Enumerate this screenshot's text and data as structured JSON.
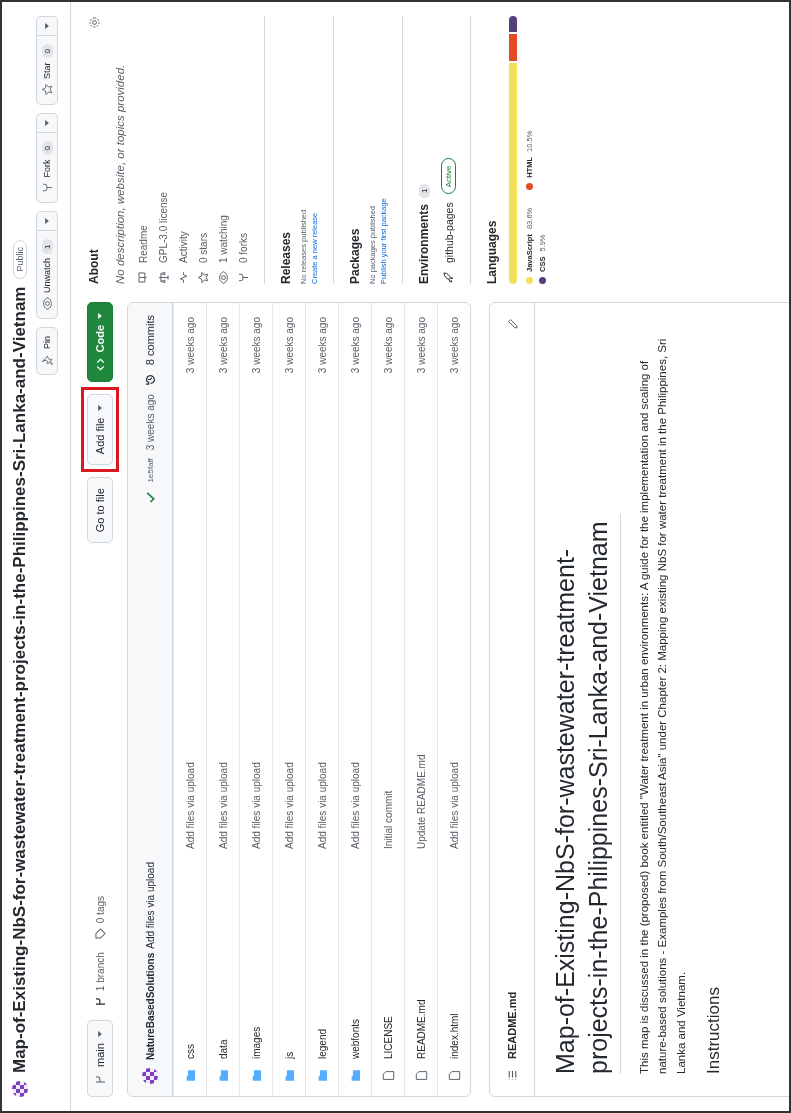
{
  "repo": {
    "title": "Map-of-Existing-NbS-for-wastewater-treatment-projects-in-the-Philippines-Sri-Lanka-and-Vietnam",
    "visibility": "Public"
  },
  "actions": [
    {
      "kind": "pin",
      "label": "Pin"
    },
    {
      "kind": "watch",
      "label": "Unwatch",
      "count": "1"
    },
    {
      "kind": "fork",
      "label": "Fork",
      "count": "0"
    },
    {
      "kind": "star",
      "label": "Star",
      "count": "0"
    }
  ],
  "branch_bar": {
    "branch": "main",
    "branches": "1 branch",
    "tags": "0 tags",
    "go_to_file": "Go to file",
    "add_file": {
      "label": "Add file",
      "highlighted": true
    },
    "code": "Code"
  },
  "latest_commit": {
    "author": "NatureBasedSolutions",
    "message": "Add files via upload",
    "hash": "1e5faff",
    "time": "3 weeks ago",
    "commits": "8 commits"
  },
  "files": [
    {
      "kind": "dir",
      "name": "css",
      "message": "Add files via upload",
      "time": "3 weeks ago"
    },
    {
      "kind": "dir",
      "name": "data",
      "message": "Add files via upload",
      "time": "3 weeks ago"
    },
    {
      "kind": "dir",
      "name": "images",
      "message": "Add files via upload",
      "time": "3 weeks ago"
    },
    {
      "kind": "dir",
      "name": "js",
      "message": "Add files via upload",
      "time": "3 weeks ago"
    },
    {
      "kind": "dir",
      "name": "legend",
      "message": "Add files via upload",
      "time": "3 weeks ago"
    },
    {
      "kind": "dir",
      "name": "webfonts",
      "message": "Add files via upload",
      "time": "3 weeks ago"
    },
    {
      "kind": "file",
      "name": "LICENSE",
      "message": "Initial commit",
      "time": "3 weeks ago"
    },
    {
      "kind": "file",
      "name": "README.md",
      "message": "Update README.md",
      "time": "3 weeks ago"
    },
    {
      "kind": "file",
      "name": "index.html",
      "message": "Add files via upload",
      "time": "3 weeks ago"
    }
  ],
  "readme": {
    "filename": "README.md",
    "heading": "Map-of-Existing-NbS-for-wastewater-treatment-projects-in-the-Philippines-Sri-Lanka-and-Vietnam",
    "paragraph": "This map is discussed in the (proposed) book entitled \"Water treatment in urban environments: A guide for the implementation and scaling of nature-based solutions - Examples from South/Southeast Asia\" under Chapter 2: Mapping existing NbS for water treatment in the Philippines, Sri Lanka and Vietnam.",
    "subheading": "Instructions"
  },
  "about": {
    "title": "About",
    "description": "No description, website, or topics provided.",
    "items": [
      {
        "kind": "book",
        "label": "Readme"
      },
      {
        "kind": "scale",
        "label": "GPL-3.0 license"
      },
      {
        "kind": "pulse",
        "label": "Activity"
      },
      {
        "kind": "star",
        "label": "0 stars"
      },
      {
        "kind": "eye",
        "label": "1 watching"
      },
      {
        "kind": "fork",
        "label": "0 forks"
      }
    ]
  },
  "releases": {
    "title": "Releases",
    "note": "No releases published",
    "link": "Create a new release"
  },
  "packages": {
    "title": "Packages",
    "note": "No packages published",
    "link": "Publish your first package"
  },
  "environments": {
    "title": "Environments",
    "count": "1",
    "name": "github-pages",
    "status": "Active"
  },
  "languages": {
    "title": "Languages",
    "items": [
      {
        "name": "JavaScript",
        "percent": "83.6%",
        "color": "#f1e05a"
      },
      {
        "name": "HTML",
        "percent": "10.5%",
        "color": "#e34c26"
      },
      {
        "name": "CSS",
        "percent": "5.9%",
        "color": "#563d7c"
      }
    ]
  }
}
